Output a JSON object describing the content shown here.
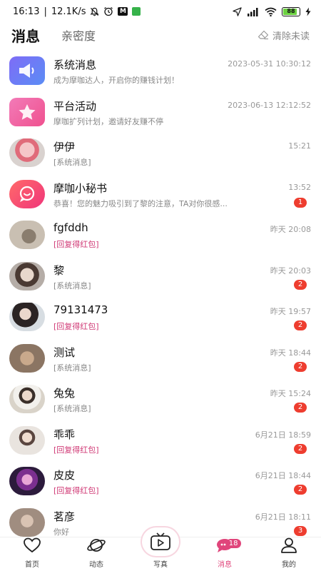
{
  "status_bar": {
    "time": "16:13",
    "speed": "12.1K/s",
    "app_badge": "M",
    "battery": "88",
    "colors": {
      "battery": "#6cd141",
      "app_badge_green": "#36b24a"
    }
  },
  "header": {
    "tab_messages": "消息",
    "tab_intimacy": "亲密度",
    "clear_unread": "清除未读"
  },
  "conversations": [
    {
      "name": "系统消息",
      "time": "2023-05-31 10:30:12",
      "message": "成为摩咖达人，开启你的赚钱计划！",
      "badge": "",
      "highlight": false,
      "avatar": "megaphone-icon"
    },
    {
      "name": "平台活动",
      "time": "2023-06-13 12:12:52",
      "message": "摩咖扩列计划，邀请好友赚不停",
      "badge": "",
      "highlight": false,
      "avatar": "star-icon"
    },
    {
      "name": "伊伊",
      "time": "15:21",
      "message": "[系统消息]",
      "badge": "",
      "highlight": false,
      "avatar": "avatar-photo"
    },
    {
      "name": "摩咖小秘书",
      "time": "13:52",
      "message": "恭喜！您的魅力吸引到了黎的注意，TA对你很感...",
      "badge": "1",
      "highlight": false,
      "avatar": "chat-bubble-icon"
    },
    {
      "name": "fgfddh",
      "time": "昨天 20:08",
      "message": "[回复得红包]",
      "badge": "",
      "highlight": true,
      "avatar": "avatar-photo"
    },
    {
      "name": "黎",
      "time": "昨天 20:03",
      "message": "[系统消息]",
      "badge": "2",
      "highlight": false,
      "avatar": "avatar-photo"
    },
    {
      "name": "79131473",
      "time": "昨天 19:57",
      "message": "[回复得红包]",
      "badge": "2",
      "highlight": true,
      "avatar": "avatar-photo"
    },
    {
      "name": "测试",
      "time": "昨天 18:44",
      "message": "[系统消息]",
      "badge": "2",
      "highlight": false,
      "avatar": "avatar-photo"
    },
    {
      "name": "兔兔",
      "time": "昨天 15:24",
      "message": "[系统消息]",
      "badge": "2",
      "highlight": false,
      "avatar": "avatar-photo"
    },
    {
      "name": "乖乖",
      "time": "6月21日 18:59",
      "message": "[回复得红包]",
      "badge": "2",
      "highlight": true,
      "avatar": "avatar-photo"
    },
    {
      "name": "皮皮",
      "time": "6月21日 18:44",
      "message": "[回复得红包]",
      "badge": "2",
      "highlight": true,
      "avatar": "avatar-photo"
    },
    {
      "name": "茗彦",
      "time": "6月21日 18:11",
      "message": "你好",
      "badge": "3",
      "highlight": false,
      "avatar": "avatar-photo"
    }
  ],
  "bottom_nav": {
    "home": "首页",
    "feed": "动态",
    "photo": "写真",
    "messages": "消息",
    "messages_badge": "18",
    "mine": "我的"
  },
  "colors": {
    "accent": "#e0457b",
    "badge": "#ee3d2f",
    "highlight_text": "#d03a76"
  }
}
